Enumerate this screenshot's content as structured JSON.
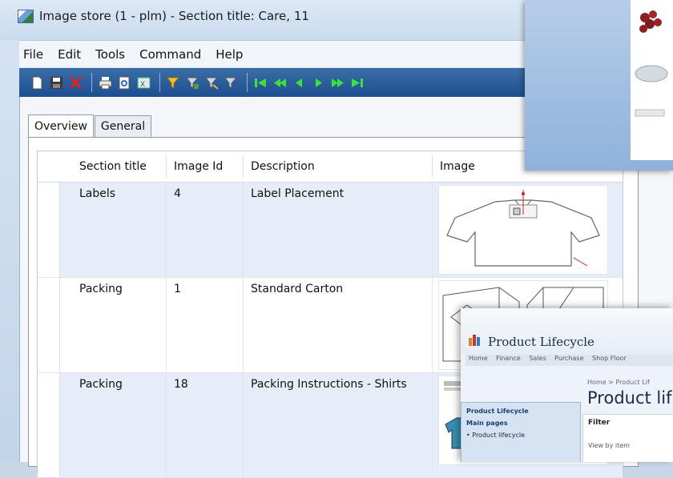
{
  "window": {
    "title": "Image store (1 - plm) - Section title: Care, 11"
  },
  "menu": [
    "File",
    "Edit",
    "Tools",
    "Command",
    "Help"
  ],
  "toolbar_icons": [
    "new-icon",
    "save-icon",
    "delete-icon",
    "print-icon",
    "print-preview-icon",
    "export-excel-icon",
    "filter-icon",
    "filter-by-selection-icon",
    "advanced-filter-icon",
    "remove-filter-icon",
    "first-record-icon",
    "previous-page-icon",
    "previous-record-icon",
    "next-record-icon",
    "next-page-icon",
    "last-record-icon"
  ],
  "tabs": [
    {
      "label": "Overview",
      "active": true
    },
    {
      "label": "General",
      "active": false
    }
  ],
  "grid": {
    "columns": [
      "Section title",
      "Image Id",
      "Description",
      "Image"
    ],
    "rows": [
      {
        "section": "Labels",
        "image_id": "4",
        "description": "Label Placement",
        "image": "shirt-label-diagram"
      },
      {
        "section": "Packing",
        "image_id": "1",
        "description": "Standard Carton",
        "image": "carton-diagram"
      },
      {
        "section": "Packing",
        "image_id": "18",
        "description": "Packing Instructions - Shirts",
        "image": "shirt-packing-diagram"
      }
    ]
  },
  "overlay_portal": {
    "title": "Product Lifecycle",
    "nav": [
      "Home",
      "Finance",
      "Sales",
      "Purchase",
      "Shop Floor"
    ],
    "crumb": "Home > Product Lif",
    "heading": "Product lif",
    "side_items": [
      "Product Lifecycle",
      "Main pages",
      "• Product lifecycle"
    ],
    "filter_label": "Filter",
    "view_by": "View by item"
  },
  "colors": {
    "toolbar": "#1d4f8f",
    "row_alt": "#e6edf8",
    "frame": "#c3d5ea"
  }
}
